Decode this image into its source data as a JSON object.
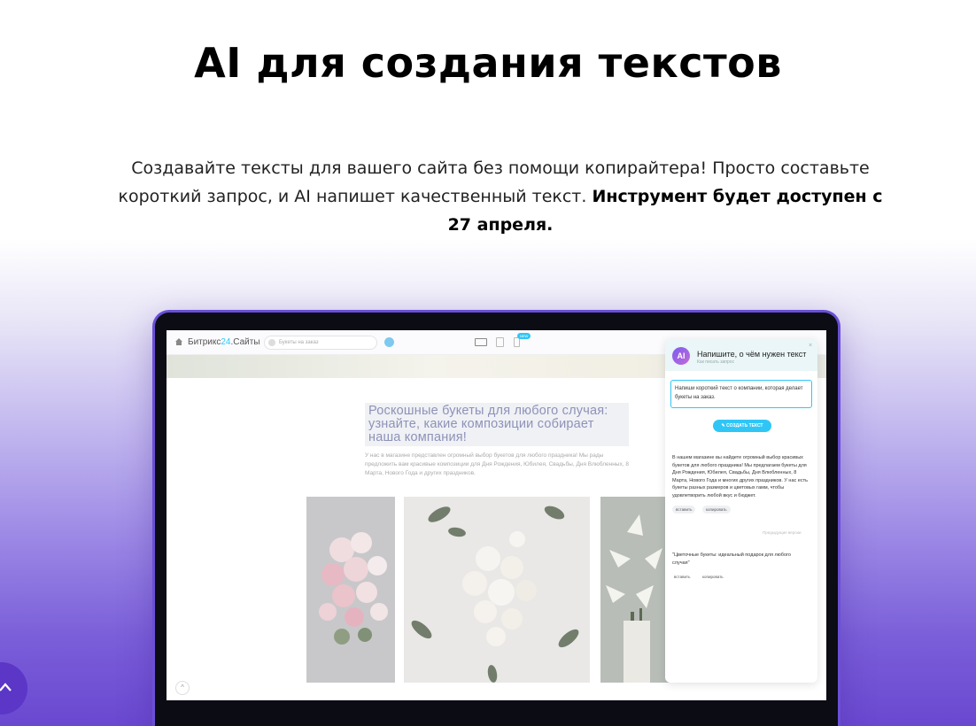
{
  "title": "AI для создания текстов",
  "lead": {
    "text": "Создавайте тексты для вашего сайта без помощи копирайтера! Просто составьте короткий запрос, и AI напишет качественный текст. ",
    "bold": "Инструмент будет доступен с 27 апреля."
  },
  "editor": {
    "brand_name": "Битрикс",
    "brand_num": "24",
    "brand_suffix": ".Сайты",
    "search_placeholder": "Букеты на заказ",
    "new_badge": "NEW",
    "site_heading": "Роскошные букеты для любого случая: узнайте, какие композиции собирает наша компания!",
    "site_text": "У нас в магазине представлен огромный выбор букетов для любого праздника! Мы рады предложить вам красивые композиции для Дня Рождения, Юбилея, Свадьбы, Дня Влюбленных, 8 Марта, Нового Года и других праздников."
  },
  "ai_panel": {
    "logo": "AI",
    "title": "Напишите, о чём нужен текст",
    "subtitle": "Как писать запрос",
    "input_value": "Напиши короткий текст о компании, которая делает букеты на заказ.",
    "create_label": "СОЗДАТЬ ТЕКСТ",
    "result_text": "В нашем магазине вы найдете огромный выбор красивых букетов для любого праздника! Мы предлагаем букеты для Дня Рождения, Юбилея, Свадьбы, Дня Влюбленных, 8 Марта, Нового Года и многих других праздников. У нас есть букеты разных размеров и цветовых гамм, чтобы удовлетворить любой вкус и бюджет.",
    "insert_label": "вставить",
    "copy_label": "копировать",
    "previous_label": "Предыдущие версии",
    "result_text_2": "\"Цветочные букеты: идеальный подарок для любого случая\""
  },
  "colors": {
    "accent": "#2fc6f6",
    "brand_purple": "#6a4fd6",
    "scroll_button": "#5b36c7"
  }
}
